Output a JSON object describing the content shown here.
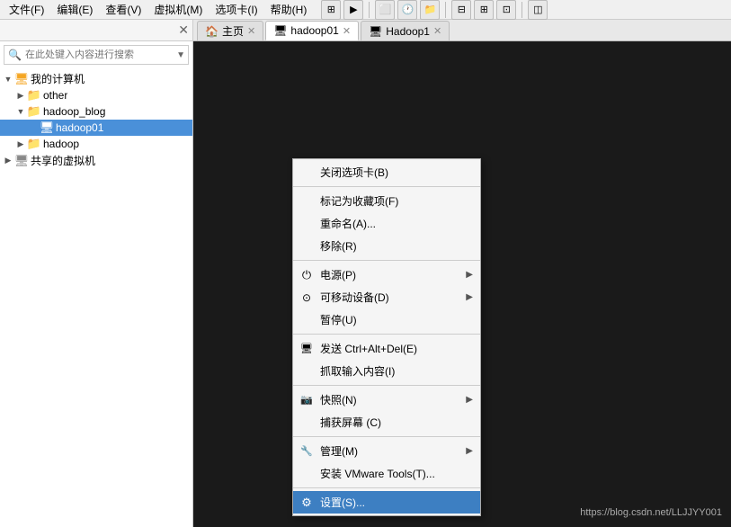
{
  "menubar": {
    "items": [
      "文件(F)",
      "编辑(E)",
      "查看(V)",
      "虚拟机(M)",
      "选项卡(I)",
      "帮助(H)"
    ]
  },
  "sidebar": {
    "title": "",
    "search_placeholder": "在此处键入内容进行搜索"
  },
  "tree": {
    "items": [
      {
        "id": "my-computer",
        "label": "我的计算机",
        "indent": 0,
        "expanded": true,
        "type": "computer"
      },
      {
        "id": "other",
        "label": "other",
        "indent": 1,
        "expanded": false,
        "type": "folder"
      },
      {
        "id": "hadoop_blog",
        "label": "hadoop_blog",
        "indent": 1,
        "expanded": true,
        "type": "folder"
      },
      {
        "id": "hadoop01",
        "label": "hadoop01",
        "indent": 2,
        "expanded": false,
        "type": "vm",
        "selected": true
      },
      {
        "id": "hadoop",
        "label": "hadoop",
        "indent": 1,
        "expanded": false,
        "type": "folder"
      },
      {
        "id": "shared-vms",
        "label": "共享的虚拟机",
        "indent": 0,
        "expanded": false,
        "type": "shared"
      }
    ]
  },
  "tabs": [
    {
      "id": "home",
      "label": "主页",
      "active": false,
      "icon": "🏠"
    },
    {
      "id": "hadoop01",
      "label": "hadoop01",
      "active": true,
      "icon": "🖥"
    },
    {
      "id": "hadoop1",
      "label": "Hadoop1",
      "active": false,
      "icon": "🖥"
    }
  ],
  "context_menu": {
    "items": [
      {
        "id": "close-tab",
        "label": "关闭选项卡(B)",
        "icon": "",
        "has_arrow": false,
        "separator_after": false
      },
      {
        "id": "sep1",
        "type": "separator"
      },
      {
        "id": "bookmark",
        "label": "标记为收藏项(F)",
        "icon": "",
        "has_arrow": false
      },
      {
        "id": "rename",
        "label": "重命名(A)...",
        "icon": "",
        "has_arrow": false
      },
      {
        "id": "remove",
        "label": "移除(R)",
        "icon": "",
        "has_arrow": false
      },
      {
        "id": "sep2",
        "type": "separator"
      },
      {
        "id": "power",
        "label": "电源(P)",
        "icon": "⏻",
        "has_arrow": true
      },
      {
        "id": "removable",
        "label": "可移动设备(D)",
        "icon": "⊙",
        "has_arrow": true
      },
      {
        "id": "pause",
        "label": "暂停(U)",
        "icon": "",
        "has_arrow": false
      },
      {
        "id": "sep3",
        "type": "separator"
      },
      {
        "id": "send-ctrlaltdel",
        "label": "发送 Ctrl+Alt+Del(E)",
        "icon": "🖥",
        "has_arrow": false
      },
      {
        "id": "grab-input",
        "label": "抓取输入内容(I)",
        "icon": "",
        "has_arrow": false
      },
      {
        "id": "sep4",
        "type": "separator"
      },
      {
        "id": "snapshot",
        "label": "快照(N)",
        "icon": "📷",
        "has_arrow": true
      },
      {
        "id": "capture-screen",
        "label": "捕获屏幕 (C)",
        "icon": "",
        "has_arrow": false
      },
      {
        "id": "sep5",
        "type": "separator"
      },
      {
        "id": "manage",
        "label": "管理(M)",
        "icon": "🔧",
        "has_arrow": true
      },
      {
        "id": "install-tools",
        "label": "安装 VMware Tools(T)...",
        "icon": "",
        "has_arrow": false
      },
      {
        "id": "sep6",
        "type": "separator"
      },
      {
        "id": "settings",
        "label": "设置(S)...",
        "icon": "⚙",
        "has_arrow": false,
        "highlighted": true
      }
    ]
  },
  "watermark": "https://blog.csdn.net/LLJJYY001"
}
